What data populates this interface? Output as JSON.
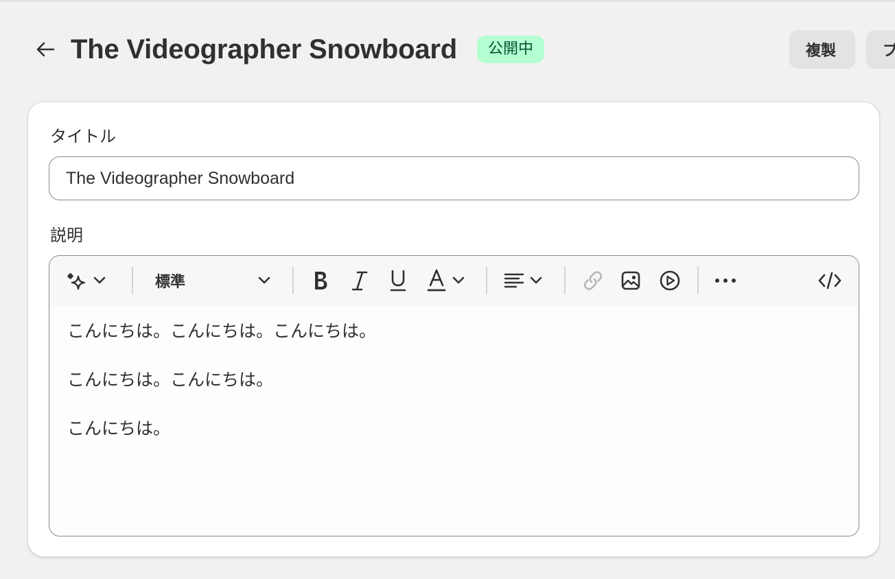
{
  "header": {
    "back_icon": "arrow-left-icon",
    "title": "The Videographer Snowboard",
    "status_badge": "公開中",
    "duplicate_label": "複製",
    "more_label": "プ"
  },
  "form": {
    "title_label": "タイトル",
    "title_value": "The Videographer Snowboard",
    "description_label": "説明",
    "toolbar": {
      "ai_icon": "sparkle-icon",
      "format_select": "標準",
      "bold_icon": "bold-icon",
      "italic_icon": "italic-icon",
      "underline_icon": "underline-icon",
      "text_color_icon": "text-color-icon",
      "align_icon": "align-left-icon",
      "link_icon": "link-icon",
      "image_icon": "image-icon",
      "video_icon": "play-circle-icon",
      "more_icon": "more-horizontal-icon",
      "code_icon": "code-icon"
    },
    "description_paragraphs": [
      "こんにちは。こんにちは。こんにちは。",
      "こんにちは。こんにちは。",
      "こんにちは。"
    ]
  },
  "colors": {
    "background": "#f1f1f1",
    "badge_bg": "#b4fed2",
    "badge_text": "#0c5132",
    "button_bg": "#e3e3e3"
  }
}
